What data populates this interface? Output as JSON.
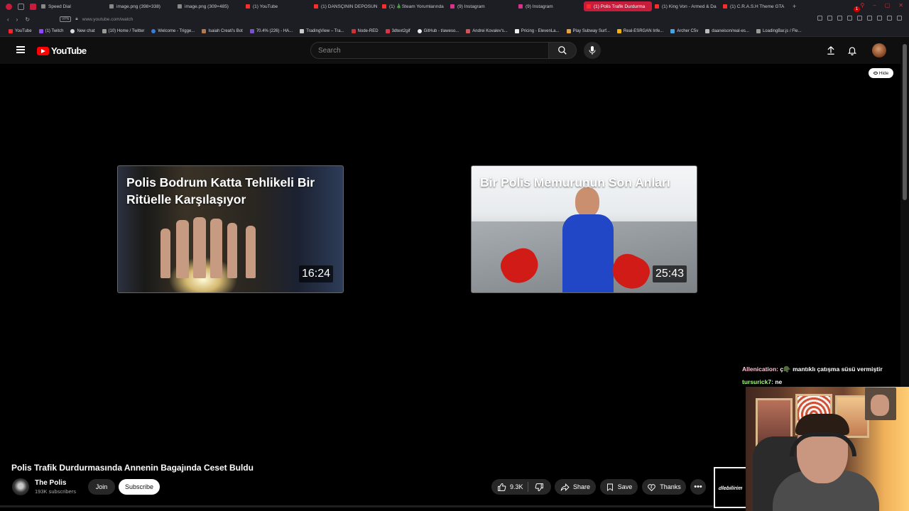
{
  "browser": {
    "tabs": [
      {
        "label": "Speed Dial",
        "icon": "grid-icon",
        "active": false
      },
      {
        "label": "image.png (398×338)",
        "icon": "file-icon",
        "active": false
      },
      {
        "label": "image.png (309×485)",
        "icon": "file-icon",
        "active": false
      },
      {
        "label": "(1) YouTube",
        "icon": "youtube-icon",
        "active": false
      },
      {
        "label": "(1) DANSÇININ DEPOSUN",
        "icon": "youtube-icon",
        "active": false
      },
      {
        "label": "(1) 🎄Steam Yorumlarında",
        "icon": "youtube-icon",
        "active": false
      },
      {
        "label": "(9) Instagram",
        "icon": "instagram-icon",
        "active": false
      },
      {
        "label": "(9) Instagram",
        "icon": "instagram-icon",
        "active": false
      },
      {
        "label": "(1) Polis Trafik Durdurma",
        "icon": "youtube-icon",
        "active": true
      },
      {
        "label": "(1) King Von - Armed & Da",
        "icon": "youtube-icon",
        "active": false
      },
      {
        "label": "(1) C.R.A.S.H Theme GTA",
        "icon": "youtube-icon",
        "active": false
      }
    ],
    "url": "www.youtube.com/watch",
    "bookmarks": [
      "YouTube",
      "(1) Twitch",
      "New chat",
      "(10) Home / Twitter",
      "Welcome - Trigge...",
      "Isaiah Creati's Bot",
      "70.4% (226) - HA...",
      "TradingView – Tra...",
      "Node-RED",
      "3dtext2gif",
      "GitHub - t/aweso...",
      "Andrei Kovalev's...",
      "Pricing - ElevenLa...",
      "Play Subway Surf...",
      "Real-ESRGAN Infe...",
      "Archer C5v",
      "daaneison/real-es...",
      "LoadingBar.js / Fle..."
    ]
  },
  "youtube": {
    "logo_text": "YouTube",
    "search_placeholder": "Search",
    "notification_count": "1",
    "hide_label": "Hide",
    "end_cards": [
      {
        "title": "Polis Bodrum Katta Tehlikeli Bir Ritüelle Karşılaşıyor",
        "duration": "16:24"
      },
      {
        "title": "Bir Polis Memurunun Son Anları",
        "duration": "25:43"
      }
    ],
    "video_title": "Polis Trafik Durdurmasında Annenin Bagajında Ceset Buldu",
    "channel": {
      "name": "The Polis",
      "subscribers": "193K subscribers"
    },
    "join_label": "Join",
    "subscribe_label": "Subscribe",
    "likes": "9.3K",
    "share_label": "Share",
    "save_label": "Save",
    "thanks_label": "Thanks",
    "more_label": "•••"
  },
  "stream_overlay": {
    "chat": [
      {
        "user": "Allenication:",
        "message": "ç🪖 mantıklı çatışma süsü vermiştir"
      },
      {
        "user": "tursurick7:",
        "message": "ne"
      }
    ],
    "sponsor_text": "dlebilirim"
  },
  "colors": {
    "accent": "#ff0000",
    "active_tab": "#c81c3c",
    "background": "#0f0f0f"
  }
}
